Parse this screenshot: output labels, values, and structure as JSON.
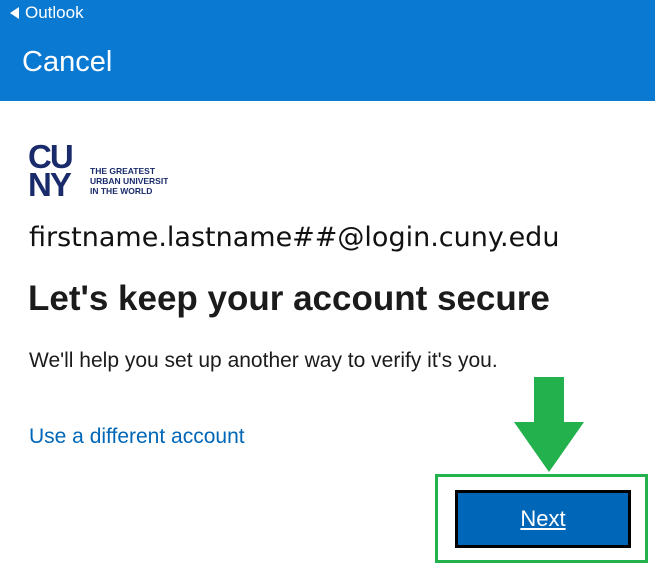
{
  "statusbar": {
    "back_label": "Outlook"
  },
  "header": {
    "cancel_label": "Cancel",
    "background": "#0A79D2"
  },
  "logo": {
    "brand": "CUNY",
    "tagline_1": "THE GREATEST",
    "tagline_2": "URBAN UNIVERSITY",
    "tagline_3": "IN THE WORLD",
    "color": "#1A2B6B"
  },
  "account": {
    "email": "firstname.lastname##@login.cuny.edu"
  },
  "main": {
    "heading": "Let's keep your account secure",
    "description": "We'll help you set up another way to verify it's you.",
    "link_label": "Use a different account",
    "next_label": "Next",
    "next_color": "#0067B8"
  },
  "annotation": {
    "arrow_color": "#22B14C",
    "icon": "down-arrow-icon"
  }
}
